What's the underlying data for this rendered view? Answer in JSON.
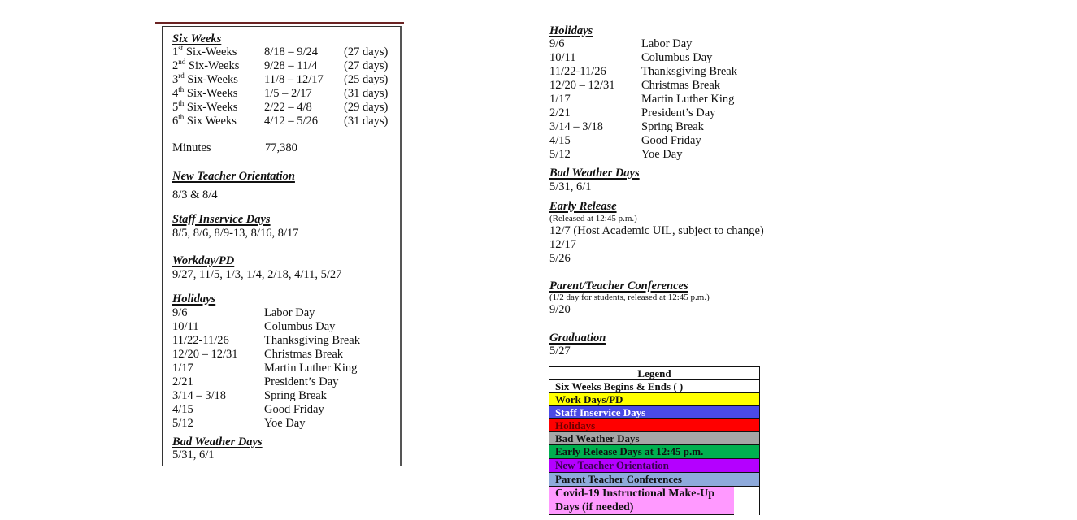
{
  "left": {
    "six_weeks": {
      "heading": "Six Weeks",
      "rows": [
        {
          "num": "1",
          "sup": "st",
          "label": " Six-Weeks",
          "range": "8/18 – 9/24",
          "days": "(27 days)"
        },
        {
          "num": "2",
          "sup": "nd",
          "label": " Six-Weeks",
          "range": "9/28 – 11/4",
          "days": "(27 days)"
        },
        {
          "num": "3",
          "sup": "rd",
          "label": " Six-Weeks",
          "range": "11/8 – 12/17",
          "days": "(25 days)"
        },
        {
          "num": "4",
          "sup": "th",
          "label": " Six-Weeks",
          "range": "1/5 – 2/17",
          "days": "(31 days)"
        },
        {
          "num": "5",
          "sup": "th",
          "label": " Six-Weeks",
          "range": "2/22 – 4/8",
          "days": "(29 days)"
        },
        {
          "num": "6",
          "sup": "th",
          "label": " Six Weeks",
          "range": "4/12 – 5/26",
          "days": "(31 days)"
        }
      ]
    },
    "minutes": {
      "label": "Minutes",
      "value": "77,380"
    },
    "new_teacher": {
      "heading": "New Teacher Orientation",
      "value": "8/3 & 8/4"
    },
    "staff_inservice": {
      "heading": "Staff Inservice Days",
      "value": "8/5, 8/6, 8/9-13, 8/16, 8/17"
    },
    "workday": {
      "heading": "Workday/PD",
      "value": "9/27, 11/5, 1/3, 1/4, 2/18, 4/11, 5/27"
    },
    "holidays": {
      "heading": "Holidays",
      "rows": [
        {
          "date": "9/6",
          "name": "Labor Day"
        },
        {
          "date": "10/11",
          "name": "Columbus Day"
        },
        {
          "date": "11/22-11/26",
          "name": "Thanksgiving Break"
        },
        {
          "date": "12/20 – 12/31",
          "name": "Christmas Break"
        },
        {
          "date": "1/17",
          "name": "Martin Luther King"
        },
        {
          "date": "2/21",
          "name": "President’s Day"
        },
        {
          "date": "3/14 – 3/18",
          "name": "Spring Break"
        },
        {
          "date": "4/15",
          "name": "Good Friday"
        },
        {
          "date": "5/12",
          "name": "Yoe Day"
        }
      ]
    },
    "bad_weather": {
      "heading": "Bad Weather Days",
      "value": "5/31, 6/1"
    }
  },
  "right": {
    "holidays": {
      "heading": "Holidays",
      "rows": [
        {
          "date": "9/6",
          "name": "Labor Day"
        },
        {
          "date": "10/11",
          "name": "Columbus Day"
        },
        {
          "date": "11/22-11/26",
          "name": "Thanksgiving Break"
        },
        {
          "date": "12/20 – 12/31",
          "name": "Christmas Break"
        },
        {
          "date": "1/17",
          "name": "Martin Luther King"
        },
        {
          "date": "2/21",
          "name": "President’s Day"
        },
        {
          "date": "3/14 – 3/18",
          "name": "Spring Break"
        },
        {
          "date": "4/15",
          "name": "Good Friday"
        },
        {
          "date": "5/12",
          "name": "Yoe Day"
        }
      ]
    },
    "bad_weather": {
      "heading": "Bad Weather Days",
      "value": "5/31, 6/1"
    },
    "early_release": {
      "heading": "Early Release",
      "note": "(Released at 12:45 p.m.)",
      "items": [
        "12/7 (Host Academic UIL, subject to change)",
        "12/17",
        "5/26"
      ]
    },
    "conferences": {
      "heading": "Parent/Teacher Conferences",
      "note": "(1/2 day for students, released at 12:45 p.m.)",
      "value": "9/20"
    },
    "graduation": {
      "heading": "Graduation",
      "value": "5/27"
    },
    "legend": {
      "title": "Legend",
      "items": [
        {
          "label": "Six Weeks Begins & Ends  (   )",
          "bg": "#ffffff",
          "fg": "#111111"
        },
        {
          "label": "Work Days/PD",
          "bg": "#ffff00",
          "fg": "#111111"
        },
        {
          "label": "Staff Inservice Days",
          "bg": "#4a4ae6",
          "fg": "#ffffff"
        },
        {
          "label": "Holidays",
          "bg": "#ff0000",
          "fg": "#6b0000"
        },
        {
          "label": "Bad Weather Days",
          "bg": "#a6a6a6",
          "fg": "#111111"
        },
        {
          "label": "Early Release Days at 12:45 p.m.",
          "bg": "#00b050",
          "fg": "#111111"
        },
        {
          "label": "New Teacher Orientation",
          "bg": "#b400ff",
          "fg": "#3a0050"
        },
        {
          "label": "Parent Teacher Conferences",
          "bg": "#8eaadb",
          "fg": "#111111"
        },
        {
          "label": "Covid-19 Instructional Make-Up Days (if needed)",
          "bg": "#ff99ff",
          "fg": "#111111"
        }
      ]
    }
  }
}
